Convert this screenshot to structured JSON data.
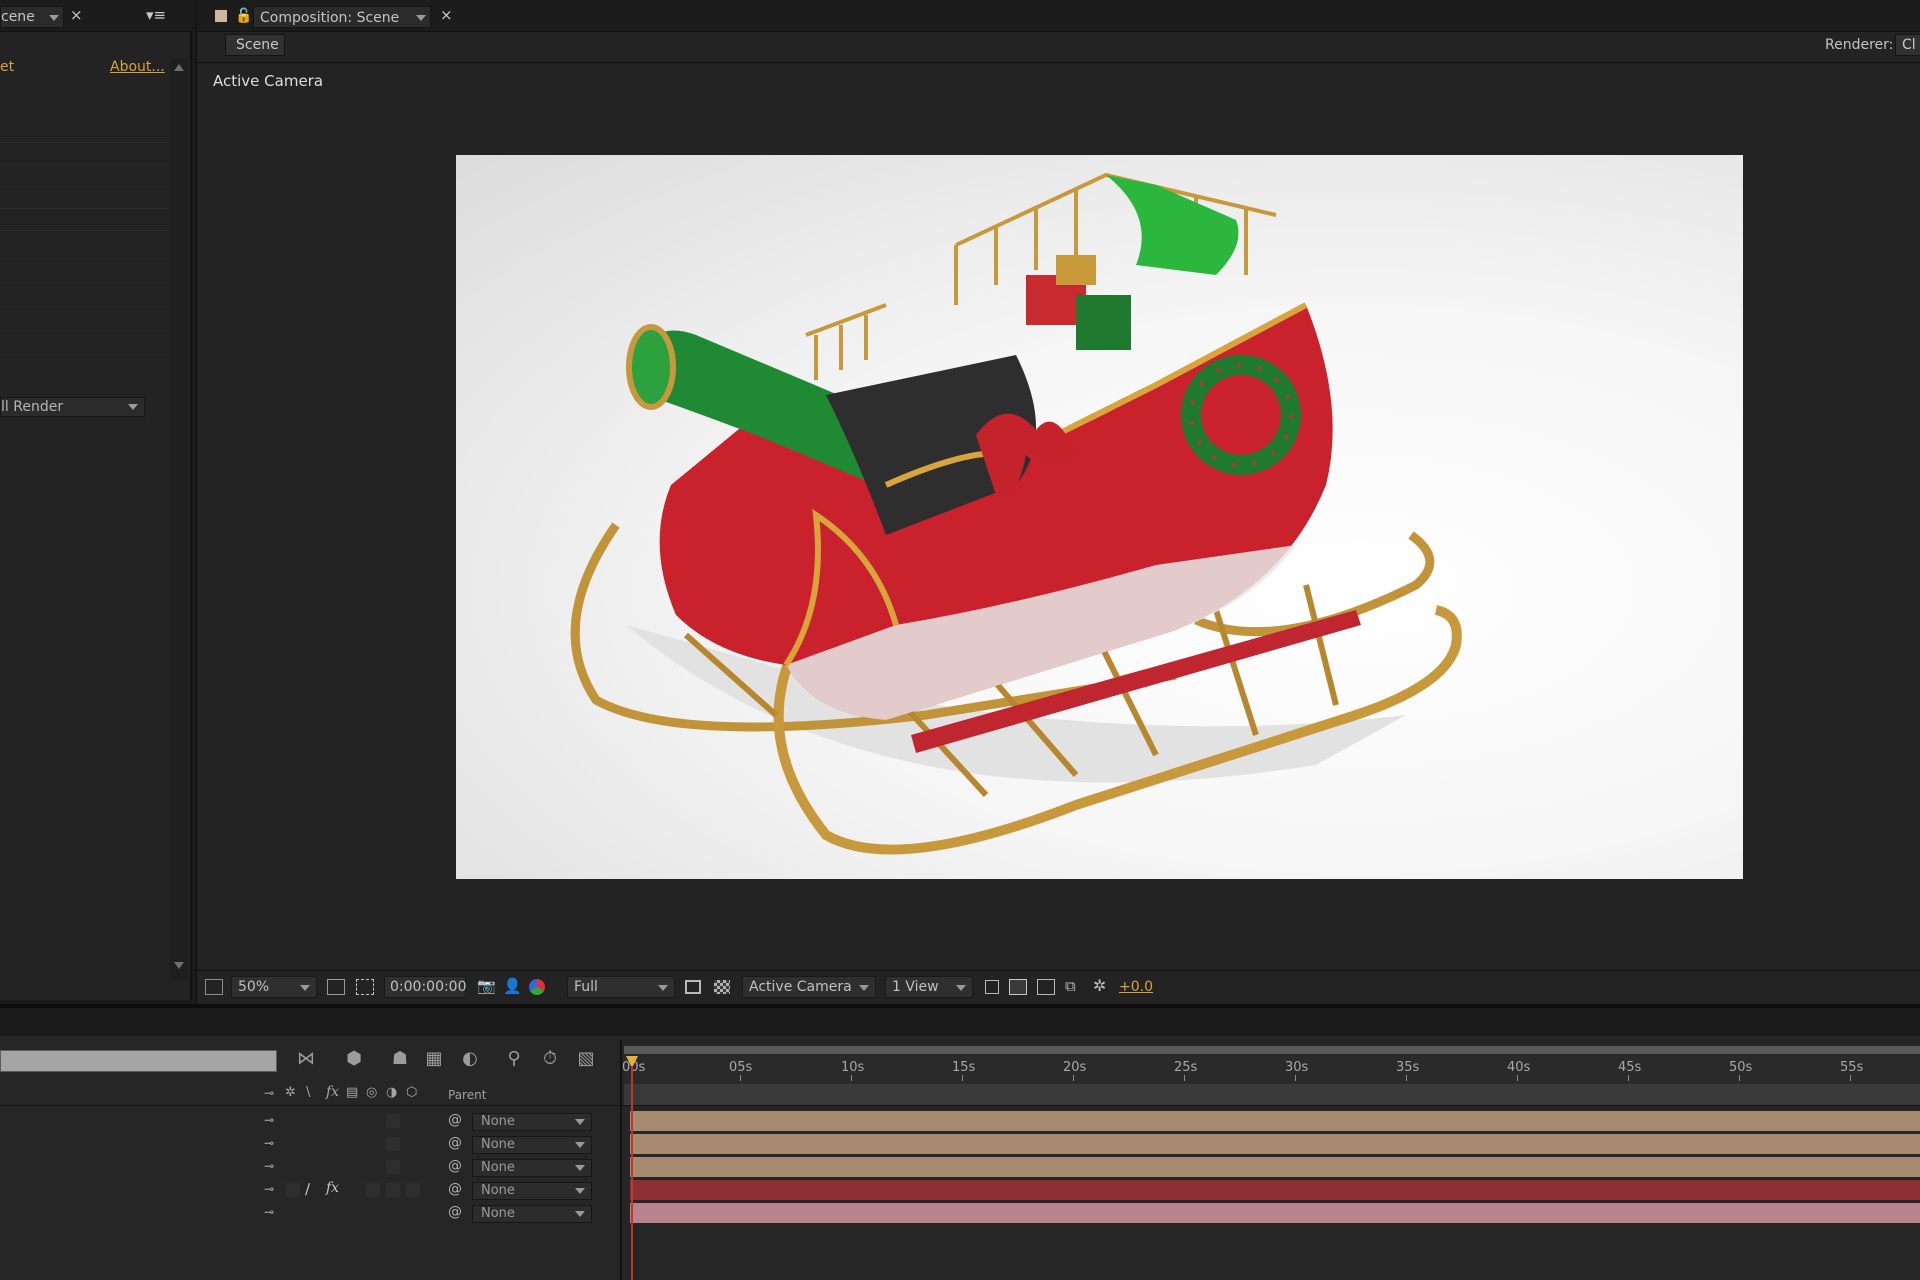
{
  "left_panel": {
    "tab_label": "cene",
    "link_left": "et",
    "link_about": "About...",
    "render_dropdown": "ll Render"
  },
  "composition_panel": {
    "tab_label": "Composition: Scene",
    "breadcrumb": "Scene",
    "renderer_label": "Renderer:",
    "renderer_value": "Cl",
    "view_label": "Active Camera"
  },
  "viewer_toolbar": {
    "zoom": "50%",
    "timecode": "0:00:00:00",
    "resolution": "Full",
    "camera": "Active Camera",
    "views": "1 View",
    "exposure": "+0.0"
  },
  "timeline": {
    "column_parent": "Parent",
    "ruler": [
      "00s",
      "05s",
      "10s",
      "15s",
      "20s",
      "25s",
      "30s",
      "35s",
      "40s",
      "45s",
      "50s",
      "55s"
    ],
    "layers": [
      {
        "parent": "None",
        "color": "#a88a70"
      },
      {
        "parent": "None",
        "color": "#a88a70"
      },
      {
        "parent": "None",
        "color": "#a88a70"
      },
      {
        "parent": "None",
        "color": "#8e2f34"
      },
      {
        "parent": "None",
        "color": "#b8838a"
      }
    ]
  }
}
